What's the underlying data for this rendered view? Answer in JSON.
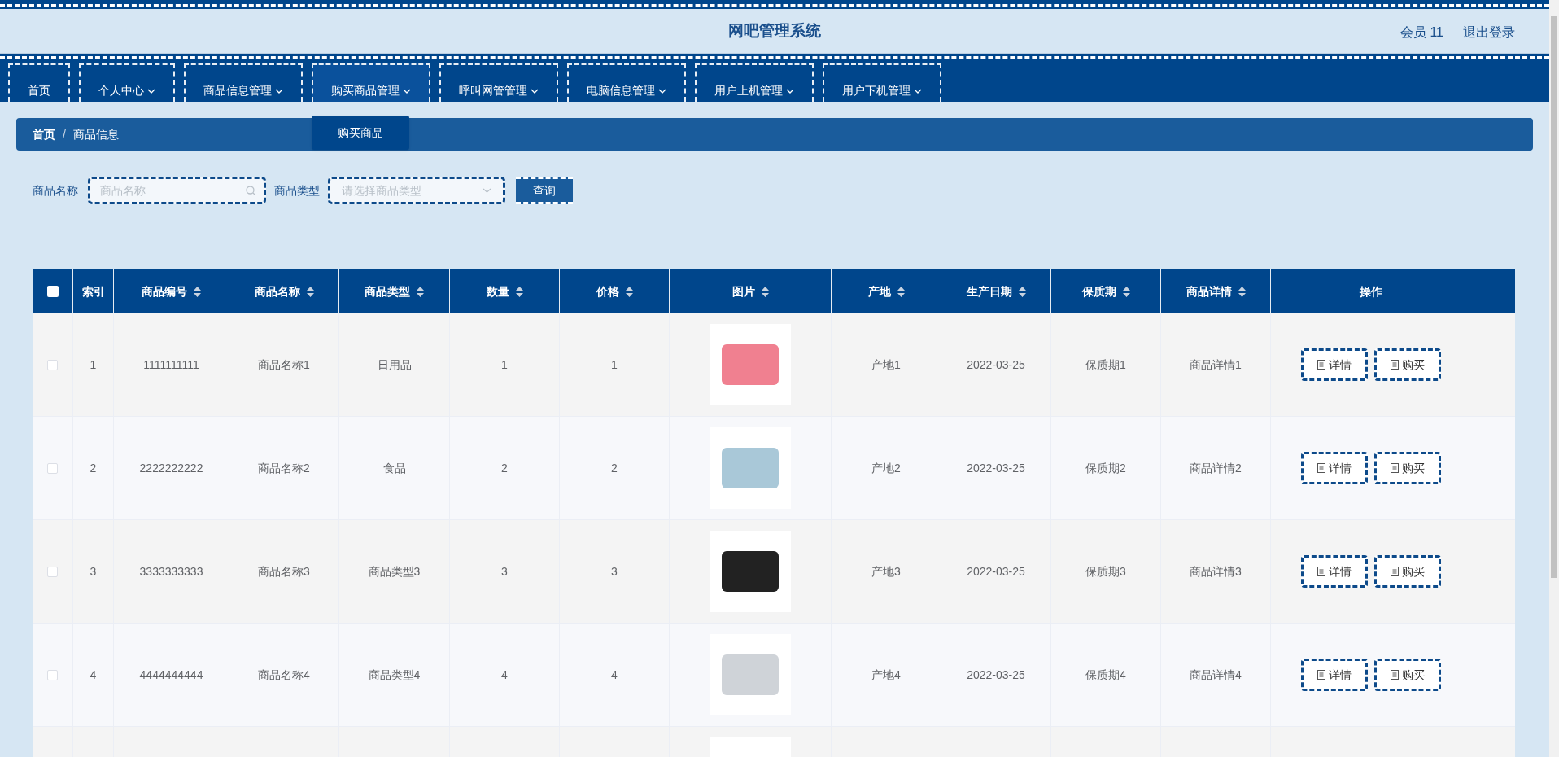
{
  "header": {
    "title": "网吧管理系统",
    "user": "会员 11",
    "logout": "退出登录"
  },
  "nav": [
    {
      "label": "首页",
      "dropdown": false
    },
    {
      "label": "个人中心",
      "dropdown": true
    },
    {
      "label": "商品信息管理",
      "dropdown": true
    },
    {
      "label": "购买商品管理",
      "dropdown": true,
      "menu": [
        "购买商品"
      ]
    },
    {
      "label": "呼叫网管管理",
      "dropdown": true
    },
    {
      "label": "电脑信息管理",
      "dropdown": true
    },
    {
      "label": "用户上机管理",
      "dropdown": true
    },
    {
      "label": "用户下机管理",
      "dropdown": true
    }
  ],
  "breadcrumb": {
    "separator": "/",
    "items": [
      "首页",
      "商品信息"
    ]
  },
  "search": {
    "name_label": "商品名称",
    "name_placeholder": "商品名称",
    "type_label": "商品类型",
    "type_placeholder": "请选择商品类型",
    "button": "查询"
  },
  "table": {
    "select_all_checked": false,
    "columns": [
      {
        "label": "索引",
        "sortable": false
      },
      {
        "label": "商品编号",
        "sortable": true
      },
      {
        "label": "商品名称",
        "sortable": true
      },
      {
        "label": "商品类型",
        "sortable": true
      },
      {
        "label": "数量",
        "sortable": true
      },
      {
        "label": "价格",
        "sortable": true
      },
      {
        "label": "图片",
        "sortable": true
      },
      {
        "label": "产地",
        "sortable": true
      },
      {
        "label": "生产日期",
        "sortable": true
      },
      {
        "label": "保质期",
        "sortable": true
      },
      {
        "label": "商品详情",
        "sortable": true
      },
      {
        "label": "操作",
        "sortable": false
      }
    ],
    "rows": [
      {
        "checked": false,
        "cells": [
          "1",
          "1111111111",
          "商品名称1",
          "日用品",
          "1",
          "1",
          "",
          "产地1",
          "2022-03-25",
          "保质期1",
          "商品详情1"
        ],
        "actions": [
          "详情",
          "购买"
        ]
      },
      {
        "checked": false,
        "cells": [
          "2",
          "2222222222",
          "商品名称2",
          "食品",
          "2",
          "2",
          "",
          "产地2",
          "2022-03-25",
          "保质期2",
          "商品详情2"
        ],
        "actions": [
          "详情",
          "购买"
        ]
      },
      {
        "checked": false,
        "cells": [
          "3",
          "3333333333",
          "商品名称3",
          "商品类型3",
          "3",
          "3",
          "",
          "产地3",
          "2022-03-25",
          "保质期3",
          "商品详情3"
        ],
        "actions": [
          "详情",
          "购买"
        ]
      },
      {
        "checked": false,
        "cells": [
          "4",
          "4444444444",
          "商品名称4",
          "商品类型4",
          "4",
          "4",
          "",
          "产地4",
          "2022-03-25",
          "保质期4",
          "商品详情4"
        ],
        "actions": [
          "详情",
          "购买"
        ]
      },
      {
        "cells": [],
        "actions": []
      }
    ]
  }
}
